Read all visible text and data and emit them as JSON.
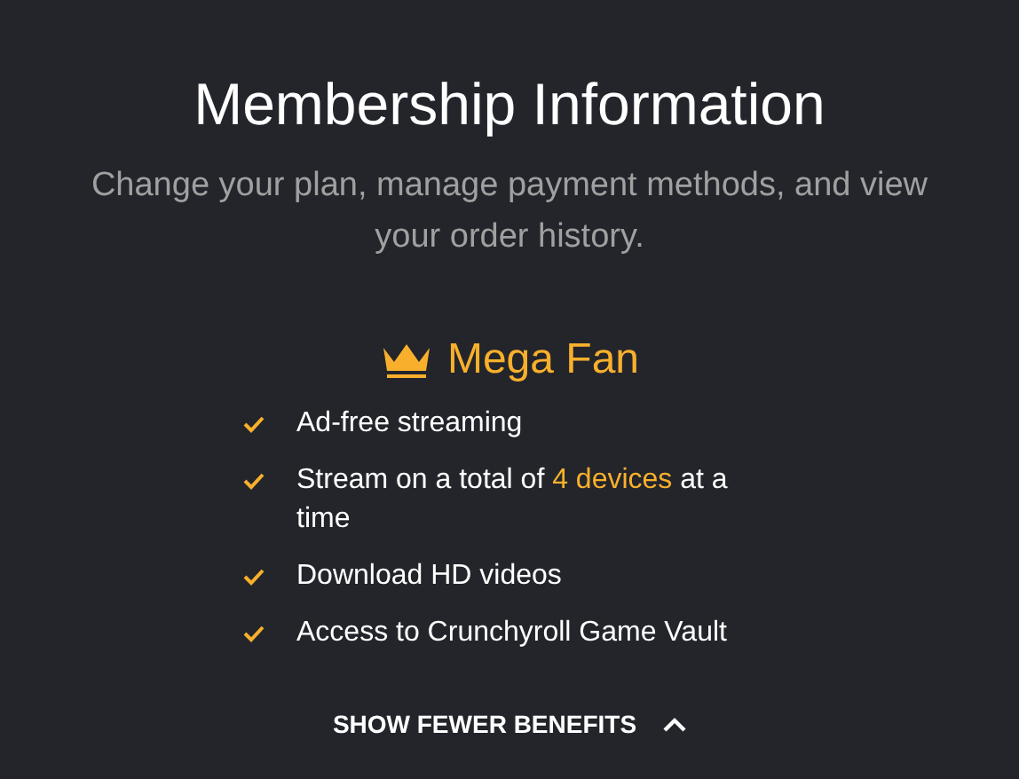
{
  "title": "Membership Information",
  "subtitle": "Change your plan, manage payment methods, and view your order history.",
  "plan": {
    "name": "Mega Fan"
  },
  "benefits": [
    {
      "parts": [
        {
          "text": "Ad-free streaming",
          "highlight": false
        }
      ]
    },
    {
      "parts": [
        {
          "text": "Stream on a total of ",
          "highlight": false
        },
        {
          "text": "4 devices",
          "highlight": true
        },
        {
          "text": " at a time",
          "highlight": false
        }
      ]
    },
    {
      "parts": [
        {
          "text": "Download HD videos",
          "highlight": false
        }
      ]
    },
    {
      "parts": [
        {
          "text": "Access to Crunchyroll Game Vault",
          "highlight": false
        }
      ]
    }
  ],
  "toggle": {
    "label": "SHOW FEWER BENEFITS",
    "expanded": true
  }
}
